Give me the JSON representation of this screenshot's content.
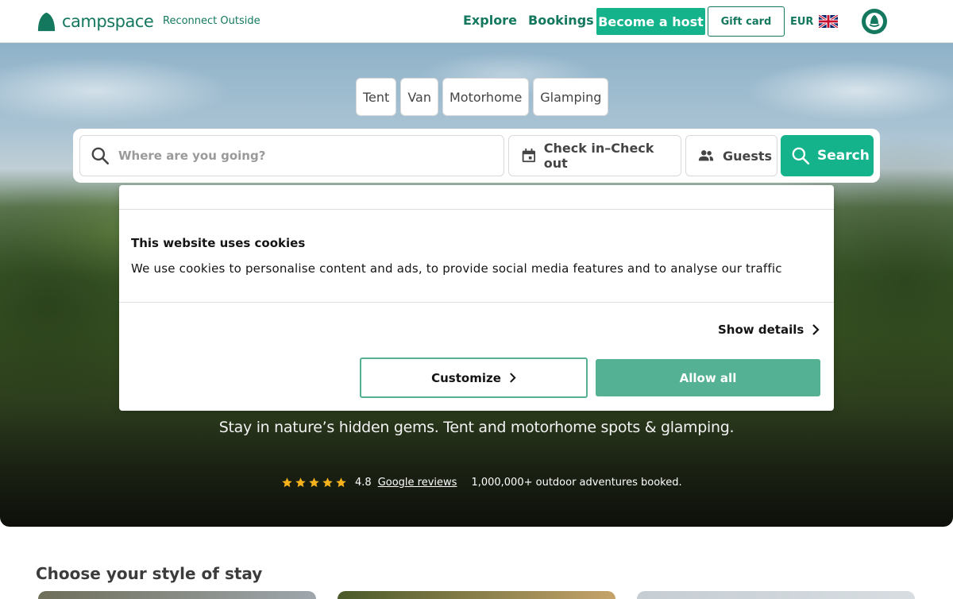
{
  "header": {
    "logo_text": "campspace",
    "tagline": "Reconnect Outside",
    "nav": {
      "explore": "Explore",
      "bookings": "Bookings"
    },
    "become_host": "Become a host",
    "gift_card": "Gift card",
    "currency": "EUR",
    "brand_color": "#14785f",
    "accent_color": "#14b38c"
  },
  "hero": {
    "chips": [
      "Tent",
      "Van",
      "Motorhome",
      "Glamping"
    ],
    "search": {
      "placeholder": "Where are you going?",
      "dates_label": "Check in–Check out",
      "guests_label": "Guests",
      "search_label": "Search"
    },
    "subtitle": "Stay in nature’s hidden gems. Tent and motorhome spots & glamping.",
    "rating": {
      "stars": 5,
      "score": "4.8",
      "link_text": "Google reviews",
      "booked_text": "1,000,000+ outdoor adventures booked."
    }
  },
  "cookie": {
    "title": "This website uses cookies",
    "text": "We use cookies to personalise content and ads, to provide social media features and to analyse our traffic",
    "show_details": "Show details",
    "customize": "Customize",
    "allow_all": "Allow all",
    "button_color": "#55b193"
  },
  "section": {
    "title": "Choose your style of stay"
  }
}
